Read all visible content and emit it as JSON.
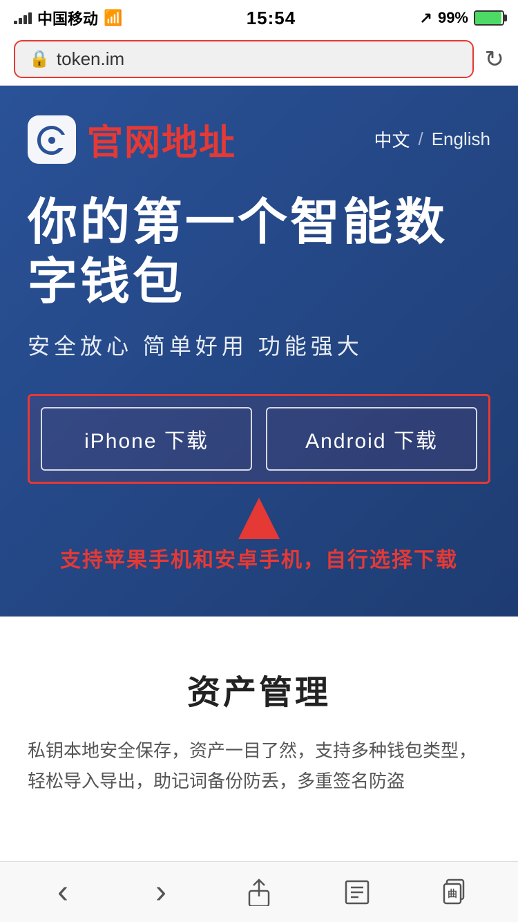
{
  "statusBar": {
    "carrier": "中国移动",
    "time": "15:54",
    "batteryPercent": "99%",
    "locationIcon": "↗"
  },
  "browserBar": {
    "url": "token.im",
    "lockIcon": "🔒"
  },
  "hero": {
    "logoSymbol": "e",
    "brandName": "官网地址",
    "langChinese": "中文",
    "langDivider": "/",
    "langEnglish": "English",
    "title": "你的第一个智能数字钱包",
    "subtitle": "安全放心  简单好用  功能强大",
    "downloadIphone": "iPhone 下载",
    "downloadAndroid": "Android 下载",
    "annotationText": "支持苹果手机和安卓手机，自行选择下载"
  },
  "contentSection": {
    "title": "资产管理",
    "description": "私钥本地安全保存，资产一目了然，支持多种钱包类型，轻松导入导出，助记词备份防丢，多重签名防盗"
  },
  "bottomNav": {
    "back": "‹",
    "forward": "›",
    "share": "↑",
    "bookmarks": "📖",
    "tabs": "⊞"
  }
}
